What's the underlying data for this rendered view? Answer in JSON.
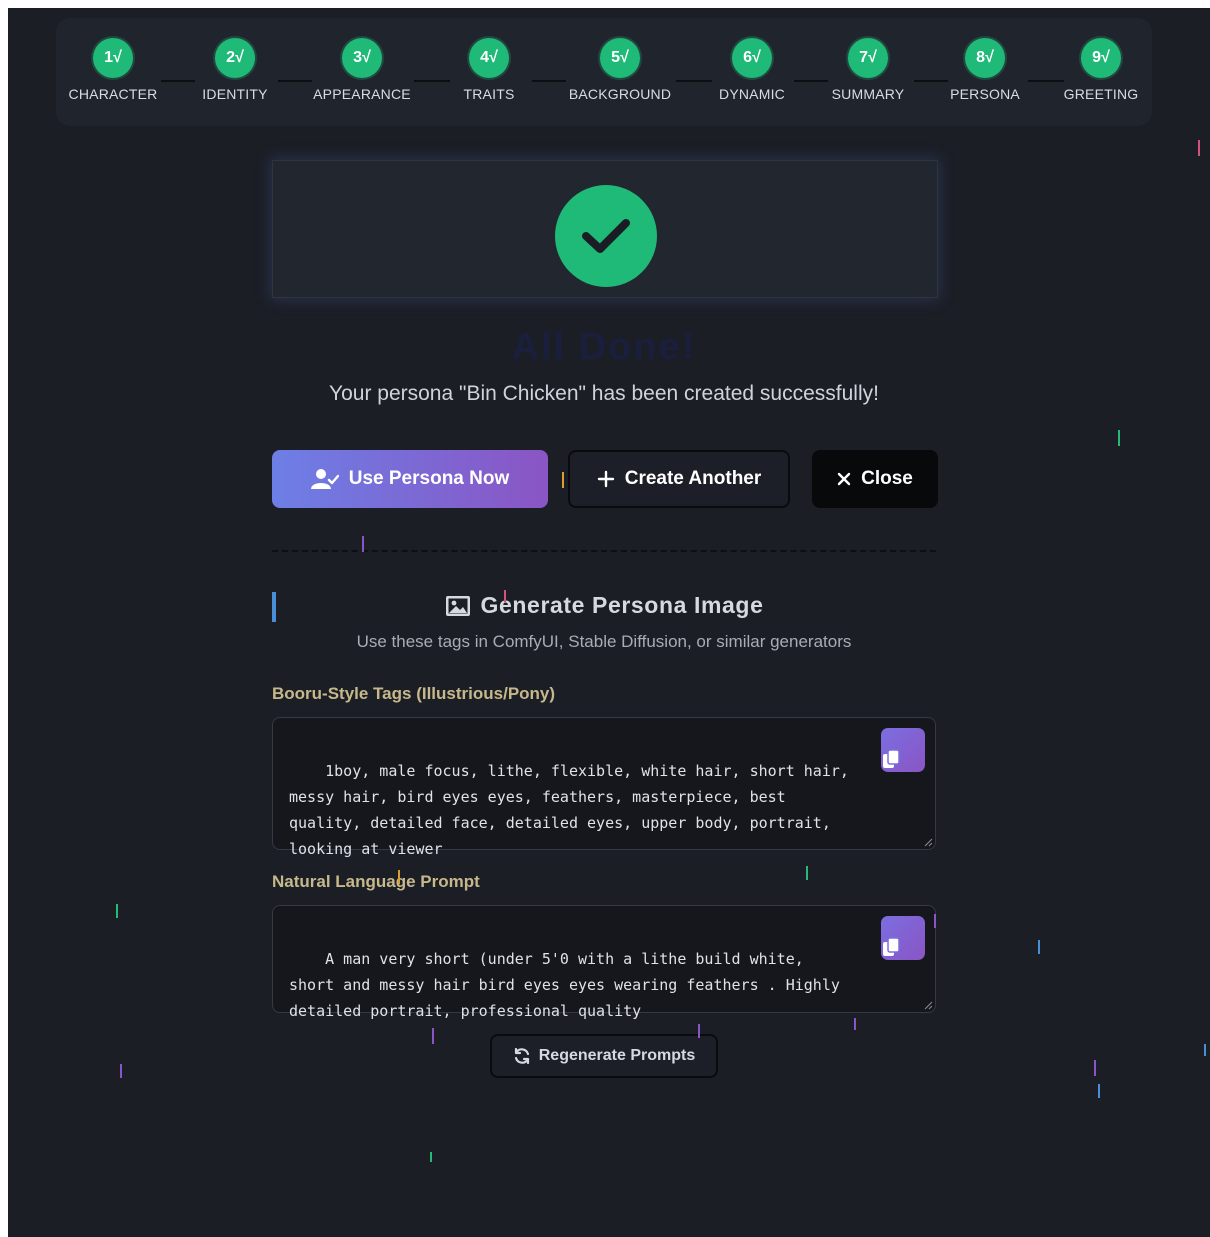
{
  "stepper": {
    "steps": [
      {
        "number": "1",
        "label": "CHARACTER"
      },
      {
        "number": "2",
        "label": "IDENTITY"
      },
      {
        "number": "3",
        "label": "APPEARANCE"
      },
      {
        "number": "4",
        "label": "TRAITS"
      },
      {
        "number": "5",
        "label": "BACKGROUND"
      },
      {
        "number": "6",
        "label": "DYNAMIC"
      },
      {
        "number": "7",
        "label": "SUMMARY"
      },
      {
        "number": "8",
        "label": "PERSONA"
      },
      {
        "number": "9",
        "label": "GREETING"
      }
    ],
    "check_mark": "√",
    "complete_color": "#1fb978"
  },
  "hero": {
    "icon": "check-icon",
    "title": "All Done!",
    "subtitle": "Your persona \"Bin Chicken\" has been created successfully!"
  },
  "actions": {
    "use_persona_label": "Use Persona Now",
    "create_another_label": "Create Another",
    "close_label": "Close"
  },
  "image_section": {
    "title": "Generate Persona Image",
    "subtitle": "Use these tags in ComfyUI, Stable Diffusion, or similar generators",
    "booru_label": "Booru-Style Tags (Illustrious/Pony)",
    "booru_value": "1boy, male focus, lithe, flexible, white hair, short hair, messy hair, bird eyes eyes, feathers, masterpiece, best quality, detailed face, detailed eyes, upper body, portrait, looking at viewer",
    "natural_label": "Natural Language Prompt",
    "natural_value": "A man very short (under 5'0 with a lithe build white, short and messy hair bird eyes eyes wearing feathers . Highly detailed portrait, professional quality",
    "regenerate_label": "Regenerate Prompts"
  },
  "colors": {
    "background": "#1b1e25",
    "accent_green": "#1fb978",
    "primary_gradient_start": "#6d7fe6",
    "primary_gradient_end": "#8a55c4",
    "label_gold": "#c7b88c"
  }
}
